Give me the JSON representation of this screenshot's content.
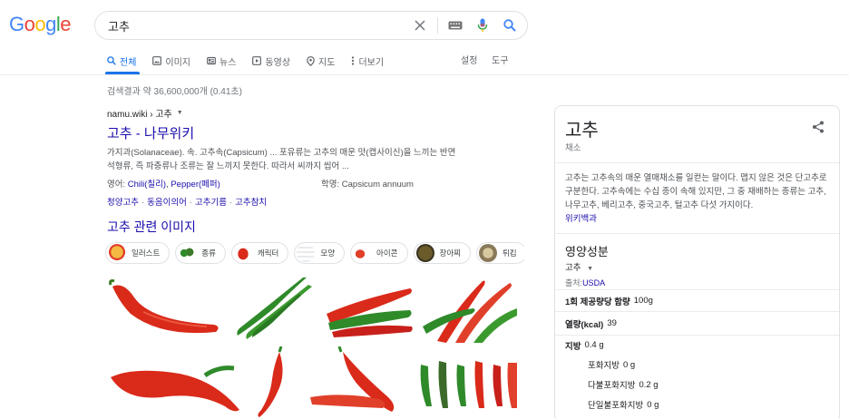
{
  "logo": {
    "text": "Google"
  },
  "search": {
    "query": "고추"
  },
  "tabs": [
    {
      "label": "전체",
      "icon": "search-icon"
    },
    {
      "label": "이미지",
      "icon": "image-icon"
    },
    {
      "label": "뉴스",
      "icon": "news-icon"
    },
    {
      "label": "동영상",
      "icon": "video-icon"
    },
    {
      "label": "지도",
      "icon": "map-pin-icon"
    },
    {
      "label": "더보기",
      "icon": "more-vert-icon"
    }
  ],
  "tools": {
    "settings": "설정",
    "tools": "도구"
  },
  "stats": "검색결과 약 36,600,000개 (0.41초)",
  "result": {
    "breadcrumb": "namu.wiki › 고추",
    "title": "고추 - 나무위키",
    "snippet_line1": "가지과(Solanaceae). 속. 고추속(Capsicum) ... 포유류는 고추의 매운 맛(캡사이신)을 느끼는 반면",
    "snippet_line2": "석형류, 즉 파충류나 조류는 잘 느끼지 못한다. 따라서 씨까지 씹어 ...",
    "english_label": "영어:",
    "english_value1": "Chili(칠리)",
    "english_value2": "Pepper(페퍼)",
    "scientific_label": "학명:",
    "scientific_value": "Capsicum annuum",
    "sitelinks": [
      "청양고추",
      "동음이의어",
      "고추기름",
      "고추참치"
    ]
  },
  "images_section": {
    "title": "고추 관련 이미지",
    "chips": [
      "일러스트",
      "종류",
      "캐릭터",
      "모양",
      "아이콘",
      "장아찌",
      "튀김"
    ]
  },
  "knowledge_panel": {
    "title": "고추",
    "subtitle": "채소",
    "desc": "고추는 고추속의 매운 열매채소를 일컫는 말이다. 맵지 않은 것은 단고추로 구분한다. 고추속에는 수십 종이 속해 있지만, 그 중 재배하는 종류는 고추, 나무고추, 베리고추, 중국고추, 털고추 다섯 가지이다.",
    "desc_link": "위키백과",
    "nutrition_title": "영양성분",
    "nutrition_selector": "고추",
    "source_label": "출처:",
    "source_link": "USDA",
    "rows": [
      {
        "label": "1회 제공량당 함량",
        "value": "100g",
        "bold": true
      },
      {
        "label": "열량(kcal)",
        "value": "39",
        "bold": true
      },
      {
        "label": "지방",
        "value": "0.4 g",
        "bold": true
      },
      {
        "label": "포화지방",
        "value": "0 g",
        "bold": false
      },
      {
        "label": "다불포화지방",
        "value": "0.2 g",
        "bold": false
      },
      {
        "label": "단일불포화지방",
        "value": "0 g",
        "bold": false
      }
    ]
  },
  "colors": {
    "link": "#1a0dab",
    "accent": "#1a73e8",
    "chili_red": "#d92a1a",
    "chili_green": "#2f8a2a"
  }
}
